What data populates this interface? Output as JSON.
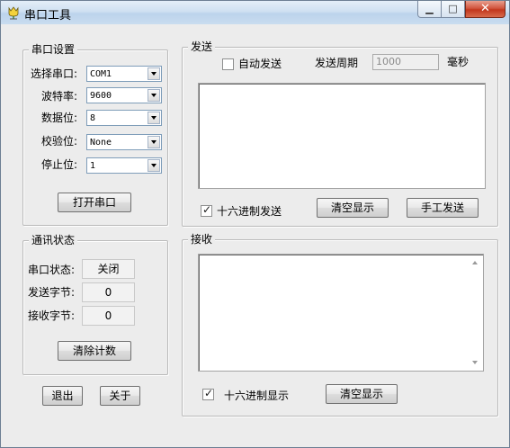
{
  "window": {
    "title": "串口工具",
    "icon": "tulip-icon",
    "controls": {
      "minimize": "▁",
      "maximize": "□",
      "close": "✕"
    }
  },
  "serial_settings": {
    "legend": "串口设置",
    "port_label": "选择串口:",
    "port_value": "COM1",
    "baud_label": "波特率:",
    "baud_value": "9600",
    "databits_label": "数据位:",
    "databits_value": "8",
    "parity_label": "校验位:",
    "parity_value": "None",
    "stopbits_label": "停止位:",
    "stopbits_value": "1",
    "open_button": "打开串口"
  },
  "comm_status": {
    "legend": "通讯状态",
    "port_state_label": "串口状态:",
    "port_state_value": "关闭",
    "sent_label": "发送字节:",
    "sent_value": "0",
    "recv_label": "接收字节:",
    "recv_value": "0",
    "clear_count_button": "清除计数"
  },
  "bottom_buttons": {
    "exit": "退出",
    "about": "关于"
  },
  "send": {
    "legend": "发送",
    "auto_send_label": "自动发送",
    "auto_send_checked": false,
    "period_label": "发送周期",
    "period_value": "1000",
    "period_unit": "毫秒",
    "text": "",
    "hex_send_label": "十六进制发送",
    "hex_send_checked": true,
    "clear_button": "清空显示",
    "manual_send_button": "手工发送"
  },
  "receive": {
    "legend": "接收",
    "text": "",
    "hex_display_label": "十六进制显示",
    "hex_display_checked": true,
    "clear_button": "清空显示"
  }
}
